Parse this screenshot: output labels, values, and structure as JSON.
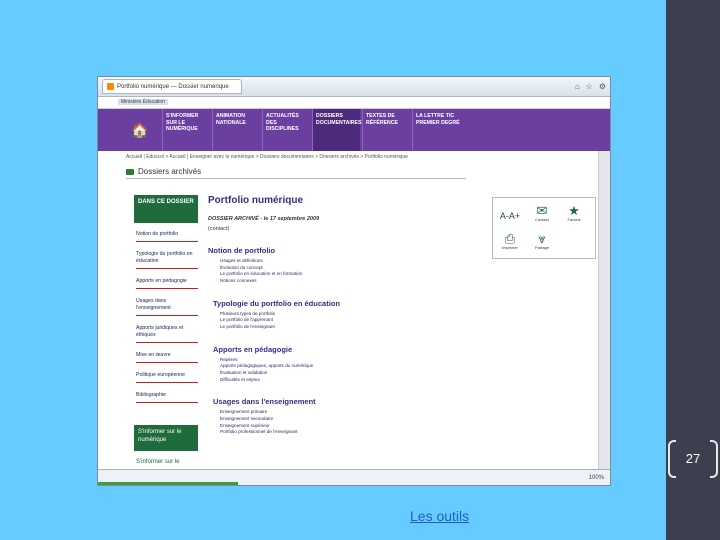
{
  "browser": {
    "tab_title": "Portfolio numérique — Dossier numérique",
    "status_zone": "100%"
  },
  "site": {
    "logo_text": "Ministère Éducation",
    "nav": [
      "S'INFORMER SUR LE NUMÉRIQUE",
      "ANIMATION NATIONALE",
      "ACTUALITÉS DES DISCIPLINES",
      "DOSSIERS DOCUMENTAIRES",
      "TEXTES DE RÉFÉRENCE",
      "LA LETTRE TIC PREMIER DEGRÉ"
    ],
    "breadcrumb": "Accueil | Éduscol > Accueil | Enseigner avec le numérique > Dossiers documentaires > Dossiers archivés > Portfolio numérique",
    "section_title": "Dossiers archivés"
  },
  "sidebar": {
    "header": "DANS CE DOSSIER",
    "items": [
      "Notion de portfolio",
      "Typologie du portfolio en éducation",
      "Apports en pédagogie",
      "Usages dans l'enseignement",
      "Apports juridiques et éthiques",
      "Mise en œuvre",
      "Politique européenne",
      "Bibliographie"
    ],
    "footer_box": "S'informer sur le numérique",
    "footer_link": "S'informer sur le"
  },
  "main": {
    "title": "Portfolio numérique",
    "subtitle": "DOSSIER ARCHIVÉ - le 17 septembre 2009",
    "contact": "(contact)",
    "sections": [
      {
        "heading": "Notion de portfolio",
        "links": [
          "Usages et définitions",
          "Évolution du concept",
          "Le portfolio en éducation et en formation",
          "Notions connexes"
        ]
      },
      {
        "heading": "Typologie du portfolio en éducation",
        "links": [
          "Plusieurs types de portfolio",
          "Le portfolio de l'apprenant",
          "Le portfolio de l'enseignant"
        ]
      },
      {
        "heading": "Apports en pédagogie",
        "links": [
          "Repères",
          "Apports pédagogiques, apports du numérique",
          "Évaluation et validation",
          "Difficultés et enjeux"
        ]
      },
      {
        "heading": "Usages dans l'enseignement",
        "links": [
          "Enseignement primaire",
          "Enseignement secondaire",
          "Enseignement supérieur",
          "Portfolio professionnel de l'enseignant"
        ]
      }
    ]
  },
  "tools": {
    "text_size": "A-A+",
    "contact": "Contact",
    "favoris": "Favoris",
    "print": "Imprimer",
    "share": "Partage"
  },
  "slide": {
    "page_number": "27",
    "link": "Les outils"
  }
}
